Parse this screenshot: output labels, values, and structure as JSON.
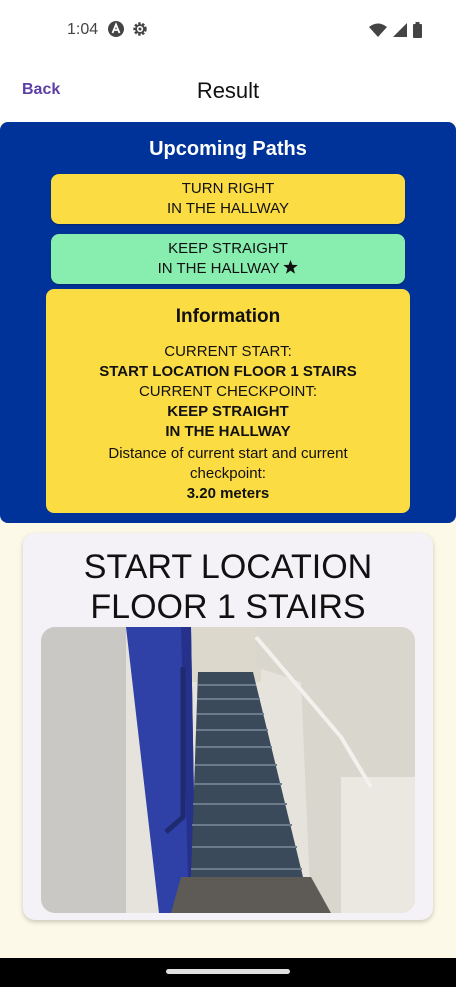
{
  "status_bar": {
    "time": "1:04"
  },
  "app_bar": {
    "back_label": "Back",
    "title": "Result"
  },
  "upcoming": {
    "title": "Upcoming Paths",
    "paths": [
      {
        "line1": "TURN RIGHT",
        "line2": "IN THE HALLWAY",
        "color": "#fcdc43"
      },
      {
        "line1": "KEEP STRAIGHT",
        "line2": "IN THE HALLWAY",
        "color": "#88eeb0",
        "starred": true
      }
    ]
  },
  "information": {
    "heading": "Information",
    "start_label": "CURRENT START:",
    "start_value": "START LOCATION FLOOR 1 STAIRS",
    "checkpoint_label": "CURRENT CHECKPOINT:",
    "checkpoint_value_line1": "KEEP STRAIGHT",
    "checkpoint_value_line2": "IN THE HALLWAY",
    "distance_label_line1": "Distance of current start and current",
    "distance_label_line2": "checkpoint:",
    "distance_value": "3.20 meters"
  },
  "location": {
    "title_line1": "START LOCATION",
    "title_line2": "FLOOR 1 STAIRS"
  },
  "colors": {
    "panel_blue": "#003399",
    "card_yellow": "#fcdc43",
    "card_green": "#88eeb0",
    "accent_purple": "#5b3ea6",
    "background": "#fdf9e8"
  }
}
